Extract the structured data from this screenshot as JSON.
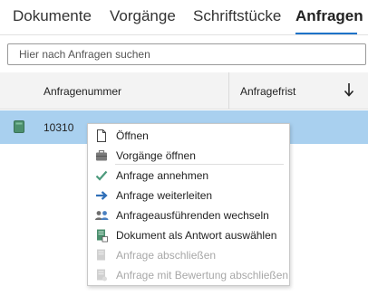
{
  "tabs": [
    {
      "label": "Dokumente"
    },
    {
      "label": "Vorgänge"
    },
    {
      "label": "Schriftstücke"
    },
    {
      "label": "Anfragen",
      "active": true
    }
  ],
  "search": {
    "placeholder": "Hier nach Anfragen suchen",
    "value": ""
  },
  "grid": {
    "columns": [
      {
        "label": "Anfragenummer"
      },
      {
        "label": "Anfragefrist",
        "sort": "descending"
      }
    ],
    "rows": [
      {
        "number": "10310",
        "selected": true
      }
    ]
  },
  "context_menu": {
    "items": [
      {
        "label": "Öffnen",
        "icon": "document-icon",
        "enabled": true
      },
      {
        "label": "Vorgänge öffnen",
        "icon": "briefcase-icon",
        "enabled": true
      },
      {
        "label": "Anfrage annehmen",
        "icon": "checkmark-icon",
        "enabled": true
      },
      {
        "label": "Anfrage weiterleiten",
        "icon": "arrow-right-icon",
        "enabled": true
      },
      {
        "label": "Anfrageausführenden wechseln",
        "icon": "users-swap-icon",
        "enabled": true
      },
      {
        "label": "Dokument als Antwort auswählen",
        "icon": "document-reply-icon",
        "enabled": true
      },
      {
        "label": "Anfrage abschließen",
        "icon": "close-request-icon",
        "enabled": false
      },
      {
        "label": "Anfrage mit Bewertung abschließen",
        "icon": "close-rated-icon",
        "enabled": false
      }
    ]
  },
  "colors": {
    "accent": "#1e73c8",
    "selected_row": "#a9d0ef",
    "checkmark": "#4c9a7c",
    "arrow": "#2f6fb8",
    "disabled_text": "#a8a8a8"
  }
}
